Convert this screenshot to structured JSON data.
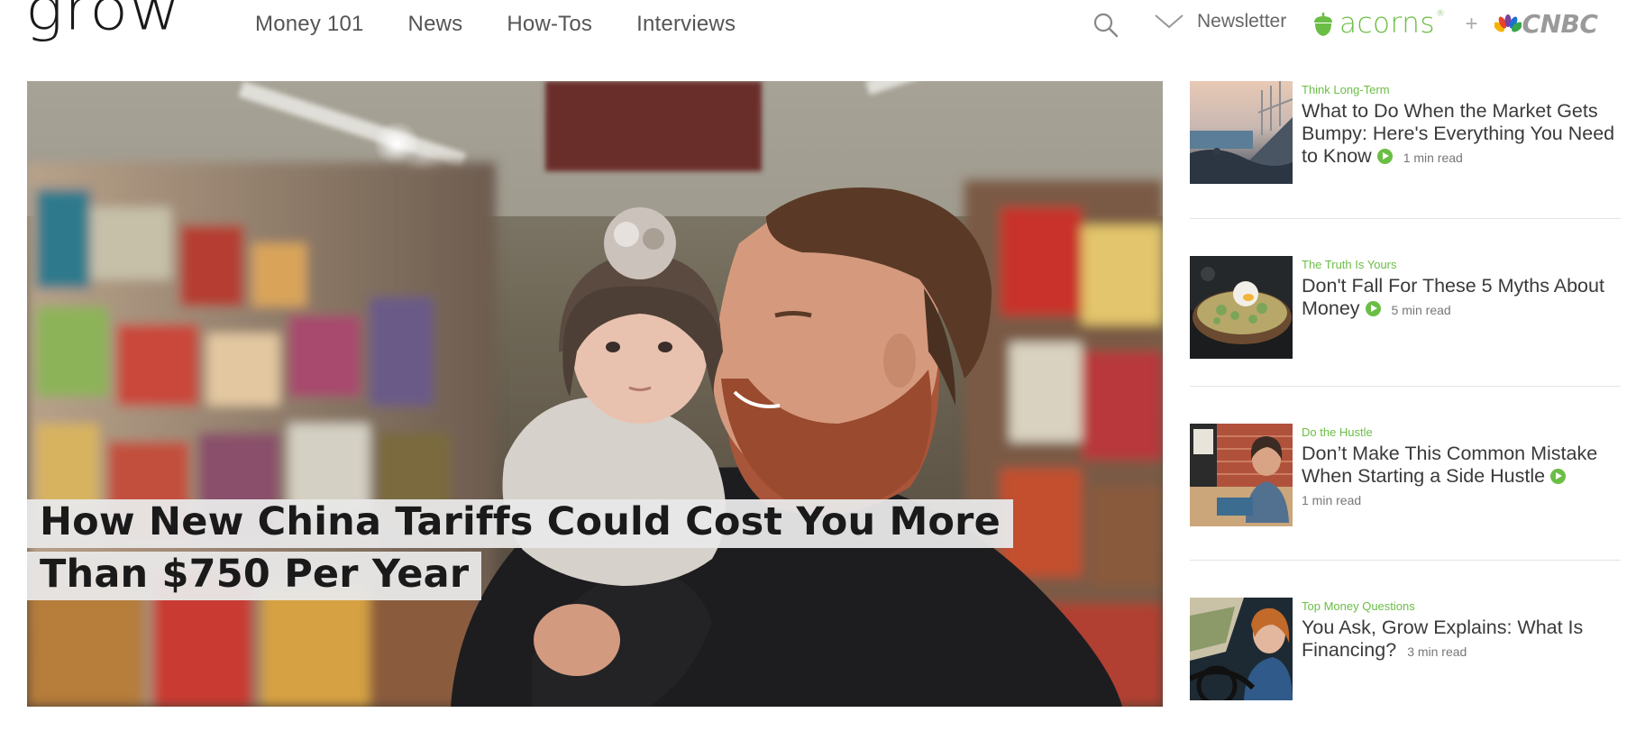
{
  "brand": {
    "logo": "grow",
    "accent": "#6bbe45"
  },
  "nav": {
    "items": [
      {
        "label": "Money 101"
      },
      {
        "label": "News"
      },
      {
        "label": "How-Tos"
      },
      {
        "label": "Interviews"
      }
    ]
  },
  "header": {
    "search_icon": "search-icon",
    "newsletter_label": "Newsletter",
    "partner_acorns": "acorns",
    "partner_acorns_mark": "®",
    "partner_plus": "+",
    "partner_cnbc": "CNBC"
  },
  "hero": {
    "title": "How New China Tariffs Could Cost You More Than $750 Per Year"
  },
  "sidebar": {
    "articles": [
      {
        "kicker": "Think Long-Term",
        "title": "What to Do When the Market Gets Bumpy: Here's Everything You Need to Know",
        "has_video": true,
        "read_time": "1 min read"
      },
      {
        "kicker": "The Truth Is Yours",
        "title": "Don't Fall For These 5 Myths About Money",
        "has_video": true,
        "read_time": "5 min read"
      },
      {
        "kicker": "Do the Hustle",
        "title": "Don’t Make This Common Mistake When Starting a Side Hustle",
        "has_video": true,
        "read_time": "1 min read"
      },
      {
        "kicker": "Top Money Questions",
        "title": "You Ask, Grow Explains: What Is Financing?",
        "has_video": false,
        "read_time": "3 min read"
      }
    ]
  }
}
